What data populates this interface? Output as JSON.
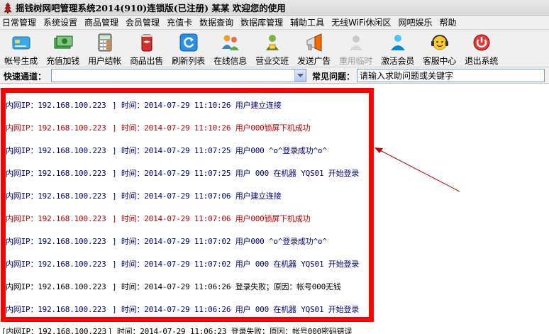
{
  "window": {
    "title": "摇钱树网吧管理系统2014(910)连锁版(已注册)  某某 欢迎您的使用"
  },
  "menu": [
    "日常管理",
    "系统设置",
    "商品管理",
    "会员管理",
    "充值卡",
    "数据查询",
    "数据库管理",
    "辅助工具",
    "无线WiFi休闲区",
    "网吧娱乐",
    "帮助"
  ],
  "toolbar": [
    {
      "label": "帐号生成",
      "icon": "card-icon"
    },
    {
      "label": "充值加钱",
      "icon": "money-icon"
    },
    {
      "label": "用户结帐",
      "icon": "calculator-icon"
    },
    {
      "label": "商品出售",
      "icon": "cola-icon"
    },
    {
      "label": "刷新列表",
      "icon": "refresh-icon"
    },
    {
      "label": "在线信息",
      "icon": "users-icon"
    },
    {
      "label": "营业交班",
      "icon": "handover-icon"
    },
    {
      "label": "发送广告",
      "icon": "megaphone-icon"
    },
    {
      "label": "重用临时",
      "icon": "reuse-icon",
      "disabled": true
    },
    {
      "label": "激活会员",
      "icon": "member-icon"
    },
    {
      "label": "客服中心",
      "icon": "headset-icon"
    },
    {
      "label": "退出系统",
      "icon": "power-icon"
    }
  ],
  "quick": {
    "channel_label": "快速通道：",
    "channel_value": "",
    "faq_label": "常见问题：",
    "faq_placeholder": "请输入求助问题或关键字"
  },
  "colors": {
    "blue": "#000080",
    "red": "#c00000",
    "black": "#000000",
    "highlight": "#ff0000"
  },
  "log": [
    {
      "ip": "内网IP：192.168.100.223",
      "time": "] 时间：2014-07-29 11:10:26",
      "msg": "用户建立连接",
      "color": "blue"
    },
    {
      "ip": "内网IP：192.168.100.223",
      "time": "] 时间：2014-07-29 11:10:26",
      "msg": "用户000锁屏下机成功",
      "color": "red"
    },
    {
      "ip": "内网IP：192.168.100.223",
      "time": "] 时间：2014-07-29 11:07:25",
      "msg": "用户000 ^o^登录成功^o^",
      "color": "blue"
    },
    {
      "ip": "内网IP：192.168.100.223",
      "time": "] 时间：2014-07-29 11:07:25",
      "msg": "用户 000 在机器 YQS01 开始登录",
      "color": "blue"
    },
    {
      "ip": "内网IP：192.168.100.223",
      "time": "] 时间：2014-07-29 11:07:06",
      "msg": "用户建立连接",
      "color": "blue"
    },
    {
      "ip": "内网IP：192.168.100.223",
      "time": "] 时间：2014-07-29 11:07:06",
      "msg": "用户000锁屏下机成功",
      "color": "red"
    },
    {
      "ip": "内网IP：192.168.100.223",
      "time": "] 时间：2014-07-29 11:07:02",
      "msg": "用户000 ^o^登录成功^o^",
      "color": "blue"
    },
    {
      "ip": "内网IP：192.168.100.223",
      "time": "] 时间：2014-07-29 11:07:02",
      "msg": "用户 000 在机器 YQS01 开始登录",
      "color": "blue"
    },
    {
      "ip": "内网IP：192.168.100.223",
      "time": "] 时间：2014-07-29 11:06:26",
      "msg": "登录失败；原因：帐号000无钱",
      "color": "black"
    },
    {
      "ip": "内网IP：192.168.100.223",
      "time": "] 时间：2014-07-29 11:06:26",
      "msg": "用户 000 在机器 YQS01 开始登录",
      "color": "blue"
    },
    {
      "ip": "[内网IP：192.168.100.223",
      "time": "] 时间：2014-07-29 11:06:23",
      "msg": "登录失败；原因：帐号000密码错误",
      "color": "black"
    }
  ]
}
